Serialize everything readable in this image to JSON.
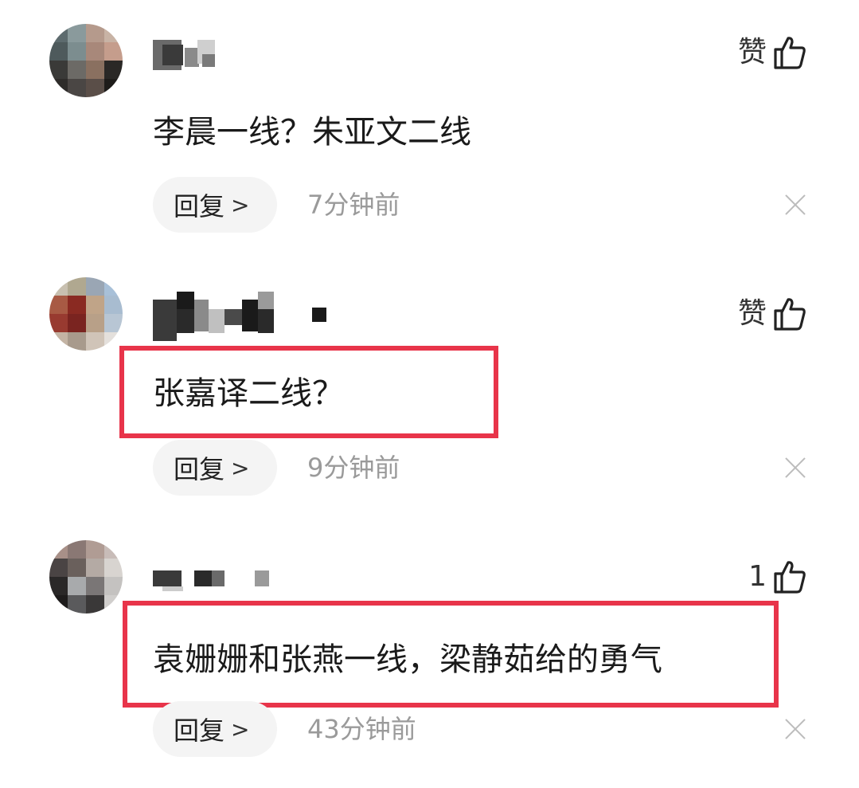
{
  "comments": [
    {
      "like_label": "赞",
      "text": "李晨一线？朱亚文二线",
      "reply_label": "回复",
      "reply_chevron": ">",
      "timestamp": "7分钟前",
      "highlighted": false
    },
    {
      "like_label": "赞",
      "text": "张嘉译二线？",
      "reply_label": "回复",
      "reply_chevron": ">",
      "timestamp": "9分钟前",
      "highlighted": true
    },
    {
      "like_label": "1",
      "text": "袁姗姗和张燕一线，梁静茹给的勇气",
      "reply_label": "回复",
      "reply_chevron": ">",
      "timestamp": "43分钟前",
      "highlighted": true
    }
  ],
  "icons": {
    "like": "thumbs-up-icon",
    "close": "close-icon",
    "chevron": "chevron-right-icon"
  },
  "colors": {
    "highlight_border": "#e8344a",
    "timestamp": "#9a9a9a",
    "reply_bg": "#f4f4f4",
    "close": "#bcbcbc"
  }
}
